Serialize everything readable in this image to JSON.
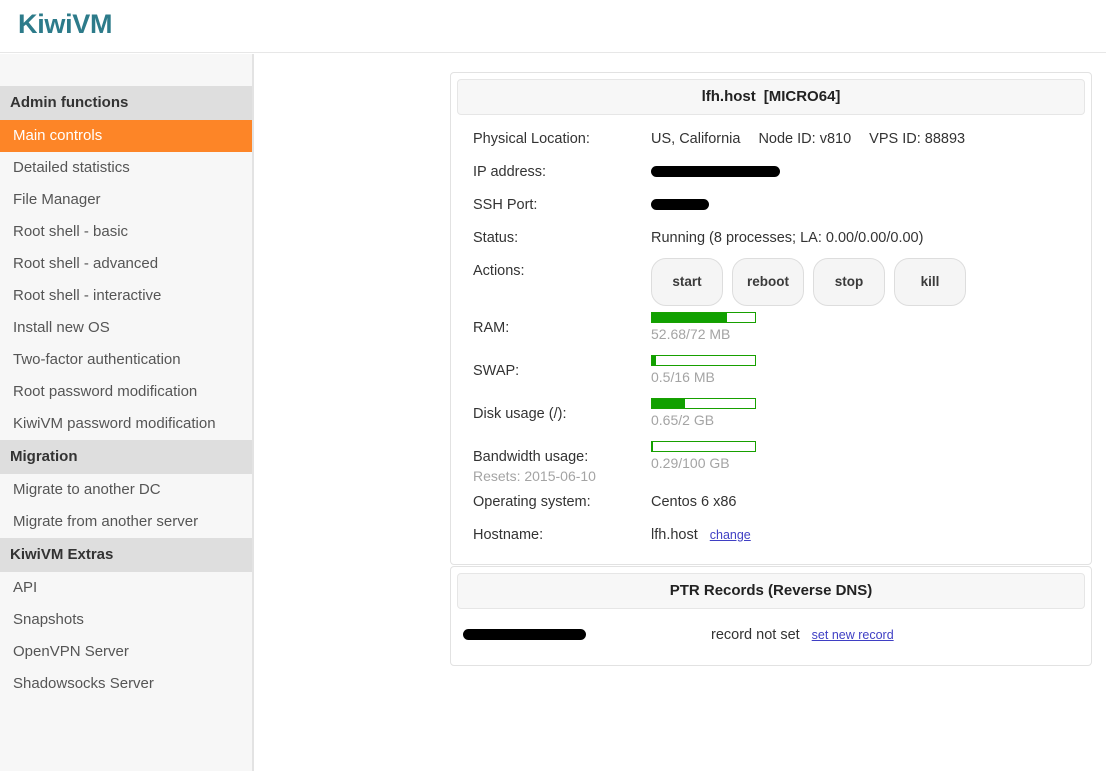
{
  "brand": "KiwiVM",
  "sidebar": {
    "groups": [
      {
        "title": "Admin functions",
        "items": [
          {
            "label": "Main controls",
            "active": true
          },
          {
            "label": "Detailed statistics",
            "active": false
          },
          {
            "label": "File Manager",
            "active": false
          },
          {
            "label": "Root shell - basic",
            "active": false
          },
          {
            "label": "Root shell - advanced",
            "active": false
          },
          {
            "label": "Root shell - interactive",
            "active": false
          },
          {
            "label": "Install new OS",
            "active": false
          },
          {
            "label": "Two-factor authentication",
            "active": false
          },
          {
            "label": "Root password modification",
            "active": false
          },
          {
            "label": "KiwiVM password modification",
            "active": false
          }
        ]
      },
      {
        "title": "Migration",
        "items": [
          {
            "label": "Migrate to another DC",
            "active": false
          },
          {
            "label": "Migrate from another server",
            "active": false
          }
        ]
      },
      {
        "title": "KiwiVM Extras",
        "items": [
          {
            "label": "API",
            "active": false
          },
          {
            "label": "Snapshots",
            "active": false
          },
          {
            "label": "OpenVPN Server",
            "active": false
          },
          {
            "label": "Shadowsocks Server",
            "active": false
          }
        ]
      }
    ]
  },
  "main_panel": {
    "title": "lfh.host",
    "title_tag": "[MICRO64]",
    "rows": {
      "physical_location_label": "Physical Location:",
      "physical_location_value": "US, California",
      "node_id": "Node ID: v810",
      "vps_id": "VPS ID: 88893",
      "ip_label": "IP address:",
      "ip_value_redacted": true,
      "ssh_label": "SSH Port:",
      "ssh_value_redacted": true,
      "status_label": "Status:",
      "status_value": "Running (8 processes; LA: 0.00/0.00/0.00)",
      "actions_label": "Actions:",
      "actions": [
        "start",
        "reboot",
        "stop",
        "kill"
      ],
      "ram_label": "RAM:",
      "ram_text": "52.68/72 MB",
      "ram_percent": 73,
      "swap_label": "SWAP:",
      "swap_text": "0.5/16 MB",
      "swap_percent": 4,
      "disk_label": "Disk usage (/):",
      "disk_text": "0.65/2 GB",
      "disk_percent": 32,
      "bandwidth_label": "Bandwidth usage:",
      "bandwidth_sublabel": "Resets: 2015-06-10",
      "bandwidth_text": "0.29/100 GB",
      "bandwidth_percent": 0.3,
      "os_label": "Operating system:",
      "os_value": "Centos 6 x86",
      "hostname_label": "Hostname:",
      "hostname_value": "lfh.host",
      "hostname_change_link": "change"
    }
  },
  "ptr_panel": {
    "title": "PTR Records (Reverse DNS)",
    "host_redacted": true,
    "state": "record not set",
    "set_link": "set new record"
  },
  "colors": {
    "brand": "#2d7b8a",
    "accent": "#fd8527",
    "meter": "#11a000",
    "link": "#3f3fc4"
  }
}
